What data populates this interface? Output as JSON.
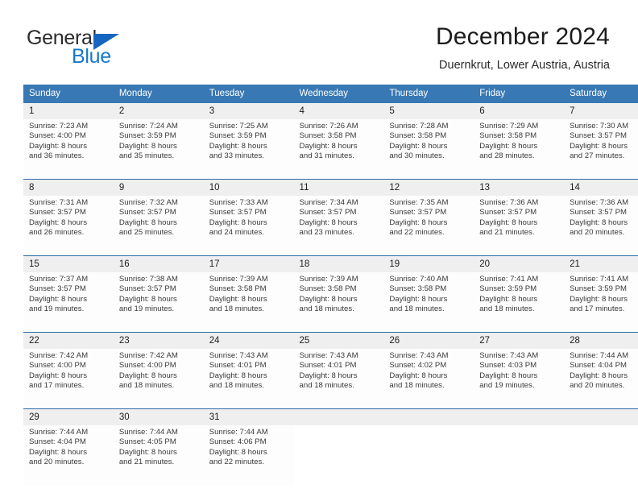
{
  "brand": {
    "name_part1": "General",
    "name_part2": "Blue",
    "triangle_color": "#1565c0",
    "blue_text_color": "#1878c8"
  },
  "header": {
    "title": "December 2024",
    "location": "Duernkrut, Lower Austria, Austria"
  },
  "theme": {
    "header_row_bg": "#3878b4",
    "header_row_text": "#ffffff",
    "daynum_band_bg": "#efefef",
    "week_separator": "#2d6aa8",
    "cell_text": "#3a3a3a"
  },
  "calendar": {
    "weekday_headers": [
      "Sunday",
      "Monday",
      "Tuesday",
      "Wednesday",
      "Thursday",
      "Friday",
      "Saturday"
    ],
    "weeks": [
      [
        {
          "day": "1",
          "sunrise": "Sunrise: 7:23 AM",
          "sunset": "Sunset: 4:00 PM",
          "daylight_line1": "Daylight: 8 hours",
          "daylight_line2": "and 36 minutes."
        },
        {
          "day": "2",
          "sunrise": "Sunrise: 7:24 AM",
          "sunset": "Sunset: 3:59 PM",
          "daylight_line1": "Daylight: 8 hours",
          "daylight_line2": "and 35 minutes."
        },
        {
          "day": "3",
          "sunrise": "Sunrise: 7:25 AM",
          "sunset": "Sunset: 3:59 PM",
          "daylight_line1": "Daylight: 8 hours",
          "daylight_line2": "and 33 minutes."
        },
        {
          "day": "4",
          "sunrise": "Sunrise: 7:26 AM",
          "sunset": "Sunset: 3:58 PM",
          "daylight_line1": "Daylight: 8 hours",
          "daylight_line2": "and 31 minutes."
        },
        {
          "day": "5",
          "sunrise": "Sunrise: 7:28 AM",
          "sunset": "Sunset: 3:58 PM",
          "daylight_line1": "Daylight: 8 hours",
          "daylight_line2": "and 30 minutes."
        },
        {
          "day": "6",
          "sunrise": "Sunrise: 7:29 AM",
          "sunset": "Sunset: 3:58 PM",
          "daylight_line1": "Daylight: 8 hours",
          "daylight_line2": "and 28 minutes."
        },
        {
          "day": "7",
          "sunrise": "Sunrise: 7:30 AM",
          "sunset": "Sunset: 3:57 PM",
          "daylight_line1": "Daylight: 8 hours",
          "daylight_line2": "and 27 minutes."
        }
      ],
      [
        {
          "day": "8",
          "sunrise": "Sunrise: 7:31 AM",
          "sunset": "Sunset: 3:57 PM",
          "daylight_line1": "Daylight: 8 hours",
          "daylight_line2": "and 26 minutes."
        },
        {
          "day": "9",
          "sunrise": "Sunrise: 7:32 AM",
          "sunset": "Sunset: 3:57 PM",
          "daylight_line1": "Daylight: 8 hours",
          "daylight_line2": "and 25 minutes."
        },
        {
          "day": "10",
          "sunrise": "Sunrise: 7:33 AM",
          "sunset": "Sunset: 3:57 PM",
          "daylight_line1": "Daylight: 8 hours",
          "daylight_line2": "and 24 minutes."
        },
        {
          "day": "11",
          "sunrise": "Sunrise: 7:34 AM",
          "sunset": "Sunset: 3:57 PM",
          "daylight_line1": "Daylight: 8 hours",
          "daylight_line2": "and 23 minutes."
        },
        {
          "day": "12",
          "sunrise": "Sunrise: 7:35 AM",
          "sunset": "Sunset: 3:57 PM",
          "daylight_line1": "Daylight: 8 hours",
          "daylight_line2": "and 22 minutes."
        },
        {
          "day": "13",
          "sunrise": "Sunrise: 7:36 AM",
          "sunset": "Sunset: 3:57 PM",
          "daylight_line1": "Daylight: 8 hours",
          "daylight_line2": "and 21 minutes."
        },
        {
          "day": "14",
          "sunrise": "Sunrise: 7:36 AM",
          "sunset": "Sunset: 3:57 PM",
          "daylight_line1": "Daylight: 8 hours",
          "daylight_line2": "and 20 minutes."
        }
      ],
      [
        {
          "day": "15",
          "sunrise": "Sunrise: 7:37 AM",
          "sunset": "Sunset: 3:57 PM",
          "daylight_line1": "Daylight: 8 hours",
          "daylight_line2": "and 19 minutes."
        },
        {
          "day": "16",
          "sunrise": "Sunrise: 7:38 AM",
          "sunset": "Sunset: 3:57 PM",
          "daylight_line1": "Daylight: 8 hours",
          "daylight_line2": "and 19 minutes."
        },
        {
          "day": "17",
          "sunrise": "Sunrise: 7:39 AM",
          "sunset": "Sunset: 3:58 PM",
          "daylight_line1": "Daylight: 8 hours",
          "daylight_line2": "and 18 minutes."
        },
        {
          "day": "18",
          "sunrise": "Sunrise: 7:39 AM",
          "sunset": "Sunset: 3:58 PM",
          "daylight_line1": "Daylight: 8 hours",
          "daylight_line2": "and 18 minutes."
        },
        {
          "day": "19",
          "sunrise": "Sunrise: 7:40 AM",
          "sunset": "Sunset: 3:58 PM",
          "daylight_line1": "Daylight: 8 hours",
          "daylight_line2": "and 18 minutes."
        },
        {
          "day": "20",
          "sunrise": "Sunrise: 7:41 AM",
          "sunset": "Sunset: 3:59 PM",
          "daylight_line1": "Daylight: 8 hours",
          "daylight_line2": "and 18 minutes."
        },
        {
          "day": "21",
          "sunrise": "Sunrise: 7:41 AM",
          "sunset": "Sunset: 3:59 PM",
          "daylight_line1": "Daylight: 8 hours",
          "daylight_line2": "and 17 minutes."
        }
      ],
      [
        {
          "day": "22",
          "sunrise": "Sunrise: 7:42 AM",
          "sunset": "Sunset: 4:00 PM",
          "daylight_line1": "Daylight: 8 hours",
          "daylight_line2": "and 17 minutes."
        },
        {
          "day": "23",
          "sunrise": "Sunrise: 7:42 AM",
          "sunset": "Sunset: 4:00 PM",
          "daylight_line1": "Daylight: 8 hours",
          "daylight_line2": "and 18 minutes."
        },
        {
          "day": "24",
          "sunrise": "Sunrise: 7:43 AM",
          "sunset": "Sunset: 4:01 PM",
          "daylight_line1": "Daylight: 8 hours",
          "daylight_line2": "and 18 minutes."
        },
        {
          "day": "25",
          "sunrise": "Sunrise: 7:43 AM",
          "sunset": "Sunset: 4:01 PM",
          "daylight_line1": "Daylight: 8 hours",
          "daylight_line2": "and 18 minutes."
        },
        {
          "day": "26",
          "sunrise": "Sunrise: 7:43 AM",
          "sunset": "Sunset: 4:02 PM",
          "daylight_line1": "Daylight: 8 hours",
          "daylight_line2": "and 18 minutes."
        },
        {
          "day": "27",
          "sunrise": "Sunrise: 7:43 AM",
          "sunset": "Sunset: 4:03 PM",
          "daylight_line1": "Daylight: 8 hours",
          "daylight_line2": "and 19 minutes."
        },
        {
          "day": "28",
          "sunrise": "Sunrise: 7:44 AM",
          "sunset": "Sunset: 4:04 PM",
          "daylight_line1": "Daylight: 8 hours",
          "daylight_line2": "and 20 minutes."
        }
      ],
      [
        {
          "day": "29",
          "sunrise": "Sunrise: 7:44 AM",
          "sunset": "Sunset: 4:04 PM",
          "daylight_line1": "Daylight: 8 hours",
          "daylight_line2": "and 20 minutes."
        },
        {
          "day": "30",
          "sunrise": "Sunrise: 7:44 AM",
          "sunset": "Sunset: 4:05 PM",
          "daylight_line1": "Daylight: 8 hours",
          "daylight_line2": "and 21 minutes."
        },
        {
          "day": "31",
          "sunrise": "Sunrise: 7:44 AM",
          "sunset": "Sunset: 4:06 PM",
          "daylight_line1": "Daylight: 8 hours",
          "daylight_line2": "and 22 minutes."
        },
        {
          "day": "",
          "sunrise": "",
          "sunset": "",
          "daylight_line1": "",
          "daylight_line2": ""
        },
        {
          "day": "",
          "sunrise": "",
          "sunset": "",
          "daylight_line1": "",
          "daylight_line2": ""
        },
        {
          "day": "",
          "sunrise": "",
          "sunset": "",
          "daylight_line1": "",
          "daylight_line2": ""
        },
        {
          "day": "",
          "sunrise": "",
          "sunset": "",
          "daylight_line1": "",
          "daylight_line2": ""
        }
      ]
    ]
  }
}
